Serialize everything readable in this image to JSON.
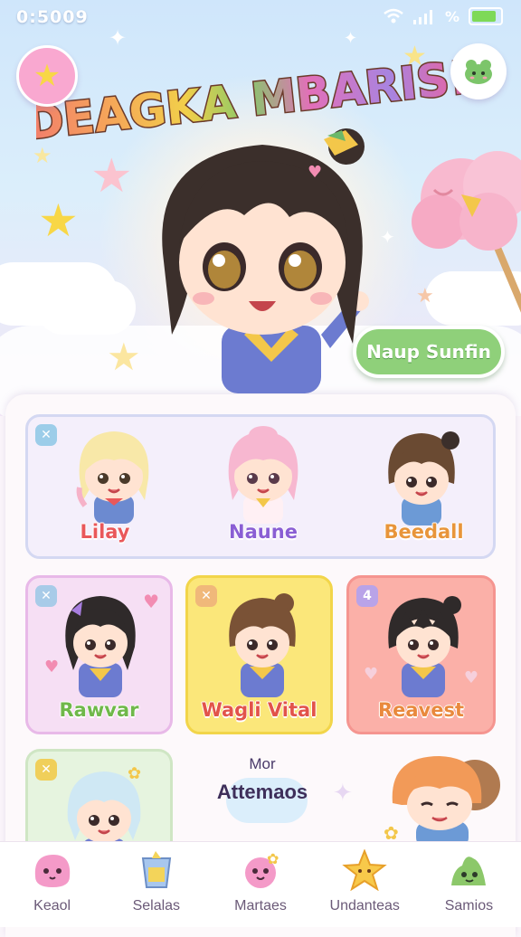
{
  "status_bar": {
    "time": "0:5009",
    "battery_text": "%"
  },
  "hero": {
    "title": "DEAGKA MBARIS!",
    "cta_label": "Naup Sunfin",
    "colors": {
      "title_letters": [
        "#ef7a7a",
        "#f5a25d",
        "#f4cf4c",
        "#8ccf6a",
        "#6bb8e8",
        "#a884e0",
        "#e97ac0"
      ]
    }
  },
  "featured_characters": [
    {
      "name": "Lilay",
      "color": "#e9585a"
    },
    {
      "name": "Naune",
      "color": "#8a5fd4"
    },
    {
      "name": "Beedall",
      "color": "#e8953a"
    }
  ],
  "cards": [
    {
      "name": "Rawvar",
      "color": "#6fb84a",
      "badge": "✕",
      "bg": "#f6dff4",
      "border": "#e8b9e8"
    },
    {
      "name": "Wagli Vital",
      "color": "#e2534a",
      "badge": "✕",
      "bg": "#fbe77a",
      "border": "#f2d54a"
    },
    {
      "name": "Reavest",
      "color": "#e9893d",
      "badge": "4",
      "bg": "#fbb0a8",
      "border": "#f59590"
    }
  ],
  "bottom_row": {
    "card_badge": "✕",
    "more_small": "Mor",
    "more_big": "Attemaos"
  },
  "tabbar": {
    "tabs": [
      {
        "label": "Keaol",
        "icon": "pink-blob-icon"
      },
      {
        "label": "Selalas",
        "icon": "cup-icon"
      },
      {
        "label": "Martaes",
        "icon": "pink-creature-icon"
      },
      {
        "label": "Undanteas",
        "icon": "star-icon"
      },
      {
        "label": "Samios",
        "icon": "green-slime-icon"
      }
    ]
  }
}
